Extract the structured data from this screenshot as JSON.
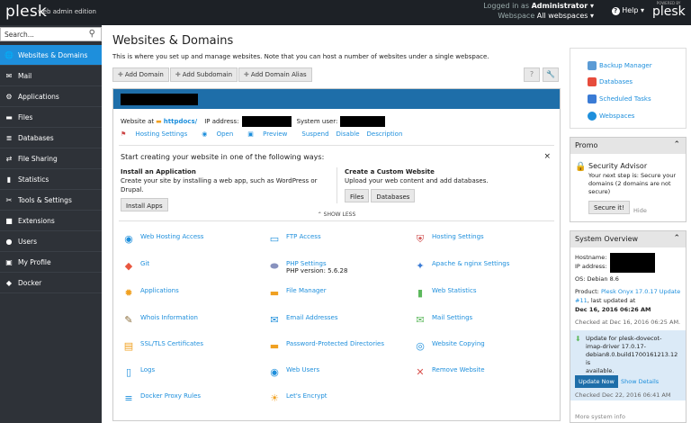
{
  "topbar": {
    "logo": "plesk",
    "edition": "web admin edition",
    "logged_in_as": "Logged in as",
    "user": "Administrator ▾",
    "webspace_label": "Webspace",
    "webspace_value": "All webspaces ▾",
    "help_label": "Help ▾",
    "powered_by": "POWERED BY",
    "powered_logo": "plesk"
  },
  "sidebar": {
    "search_placeholder": "Search...",
    "items": [
      {
        "label": "Websites & Domains",
        "icon": "globe-icon",
        "active": true
      },
      {
        "label": "Mail",
        "icon": "mail-icon"
      },
      {
        "label": "Applications",
        "icon": "applications-icon"
      },
      {
        "label": "Files",
        "icon": "folder-icon"
      },
      {
        "label": "Databases",
        "icon": "database-icon"
      },
      {
        "label": "File Sharing",
        "icon": "file-sharing-icon"
      },
      {
        "label": "Statistics",
        "icon": "statistics-icon"
      },
      {
        "label": "Tools & Settings",
        "icon": "tools-icon"
      },
      {
        "label": "Extensions",
        "icon": "extensions-icon"
      },
      {
        "label": "Users",
        "icon": "users-icon"
      },
      {
        "label": "My Profile",
        "icon": "profile-icon"
      },
      {
        "label": "Docker",
        "icon": "docker-icon"
      }
    ]
  },
  "main": {
    "title": "Websites & Domains",
    "intro": "This is where you set up and manage websites. Note that you can host a number of websites under a single webspace.",
    "toolbar": [
      "Add Domain",
      "Add Subdomain",
      "Add Domain Alias"
    ],
    "tools": [
      "?",
      "🔧"
    ],
    "domain": {
      "website_at": "Website at",
      "httpdocs": "httpdocs/",
      "ip_label": "IP address:",
      "sysuser_label": "System user:",
      "actions": [
        "Hosting Settings",
        "Open",
        "Preview",
        "Suspend",
        "Disable",
        "Description"
      ]
    },
    "start": {
      "title": "Start creating your website in one of the following ways:",
      "close": "×",
      "install_title": "Install an Application",
      "install_desc": "Create your site by installing a web app, such as WordPress or Drupal.",
      "install_button": "Install Apps",
      "custom_title": "Create a Custom Website",
      "custom_desc": "Upload your web content and add databases.",
      "custom_buttons": [
        "Files",
        "Databases"
      ],
      "show_less": "⌃ SHOW LESS"
    },
    "tools_grid": [
      {
        "label": "Web Hosting Access",
        "icon": "web-hosting-access-icon"
      },
      {
        "label": "FTP Access",
        "icon": "ftp-access-icon"
      },
      {
        "label": "Hosting Settings",
        "icon": "hosting-settings-icon"
      },
      {
        "label": "Git",
        "icon": "git-icon"
      },
      {
        "label": "PHP Settings",
        "icon": "php-icon",
        "sub": "PHP version: 5.6.28"
      },
      {
        "label": "Apache & nginx Settings",
        "icon": "apache-icon"
      },
      {
        "label": "Applications",
        "icon": "applications-gear-icon"
      },
      {
        "label": "File Manager",
        "icon": "file-manager-icon"
      },
      {
        "label": "Web Statistics",
        "icon": "web-statistics-icon"
      },
      {
        "label": "Whois Information",
        "icon": "whois-icon"
      },
      {
        "label": "Email Addresses",
        "icon": "email-icon"
      },
      {
        "label": "Mail Settings",
        "icon": "mail-settings-icon"
      },
      {
        "label": "SSL/TLS Certificates",
        "icon": "certificate-icon"
      },
      {
        "label": "Password-Protected Directories",
        "icon": "protected-dir-icon"
      },
      {
        "label": "Website Copying",
        "icon": "website-copying-icon"
      },
      {
        "label": "Logs",
        "icon": "logs-icon"
      },
      {
        "label": "Web Users",
        "icon": "web-users-icon"
      },
      {
        "label": "Remove Website",
        "icon": "remove-icon"
      },
      {
        "label": "Docker Proxy Rules",
        "icon": "docker-proxy-icon"
      },
      {
        "label": "Let's Encrypt",
        "icon": "lets-encrypt-icon"
      }
    ]
  },
  "right": {
    "links": [
      "Backup Manager",
      "Databases",
      "Scheduled Tasks",
      "Webspaces"
    ],
    "promo": {
      "title": "Promo",
      "heading": "Security Advisor",
      "text1": "Your next step is: Secure your",
      "text2": "domains (2 domains are not",
      "text3": "secure)",
      "button": "Secure it!",
      "hide": "Hide"
    },
    "overview": {
      "title": "System Overview",
      "hostname": "Hostname:",
      "ip": "IP address:",
      "os": "OS: Debian 8.6",
      "product_label": "Product:",
      "product_link": "Plesk Onyx 17.0.17 Update",
      "product_link2": "#11",
      "product_rest": ", last updated at",
      "product_date": "Dec 16, 2016 06:26 AM",
      "checked": "Checked at Dec 16, 2016 06:25 AM.",
      "update_text1": "Update for plesk-dovecot-",
      "update_text2": "imap-driver 17.0.17-",
      "update_text3": "debian8.0.build1700161213.12 is",
      "update_text4": "available.",
      "update_button": "Update Now",
      "show_details": "Show Details",
      "checked2": "Checked Dec 22, 2016 06:41 AM",
      "more": "More system info"
    }
  }
}
